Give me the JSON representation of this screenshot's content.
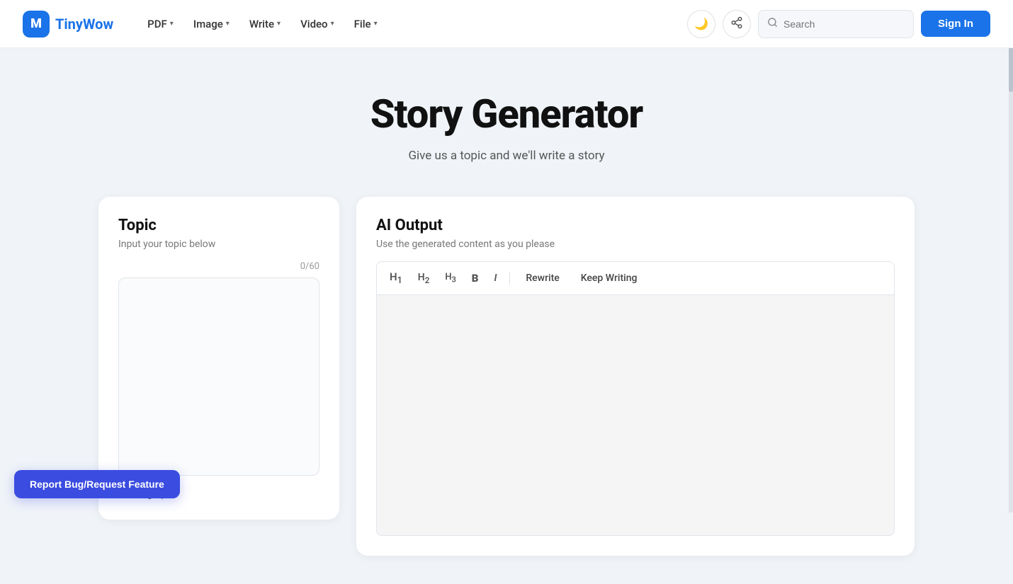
{
  "brand": {
    "logo_letter": "M",
    "name_part1": "Tiny",
    "name_part2": "Wow"
  },
  "nav": {
    "items": [
      {
        "label": "PDF",
        "has_chevron": true
      },
      {
        "label": "Image",
        "has_chevron": true
      },
      {
        "label": "Write",
        "has_chevron": true
      },
      {
        "label": "Video",
        "has_chevron": true
      },
      {
        "label": "File",
        "has_chevron": true
      }
    ],
    "search_placeholder": "Search",
    "signin_label": "Sign In"
  },
  "hero": {
    "title": "Story Generator",
    "subtitle": "Give us a topic and we'll write a story"
  },
  "topic_panel": {
    "title": "Topic",
    "subtitle": "Input your topic below",
    "char_count": "0/60",
    "textarea_placeholder": "",
    "paragraphs_label": "# Paragraphs"
  },
  "ai_panel": {
    "title": "AI Output",
    "subtitle": "Use the generated content as you please",
    "toolbar": {
      "h1": "H₁",
      "h2": "H₂",
      "h3": "H₃",
      "bold": "B",
      "italic": "I",
      "rewrite": "Rewrite",
      "keep_writing": "Keep Writing"
    }
  },
  "footer": {
    "report_btn": "Report Bug/Request Feature"
  }
}
